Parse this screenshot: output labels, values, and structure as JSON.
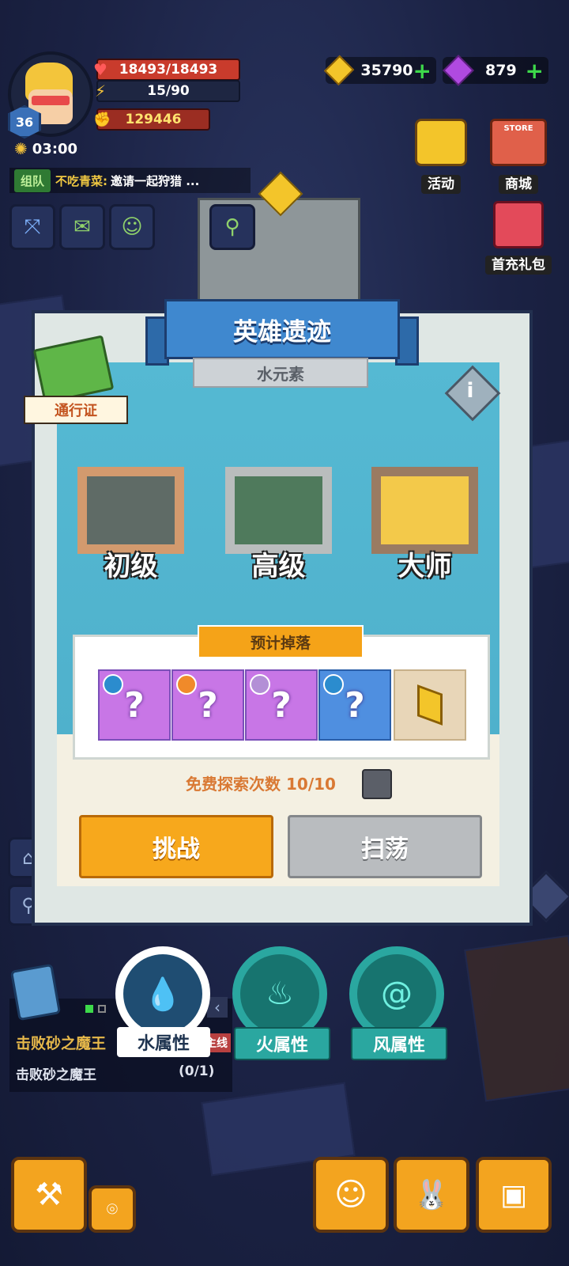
{
  "hud": {
    "level": "36",
    "hp": "18493/18493",
    "stamina": "15/90",
    "power": "129446",
    "gold": "35790",
    "gems": "879",
    "timer": "03:00",
    "chat_tag": "组队",
    "chat_user": "不吃青菜:",
    "chat_text": "邀请一起狩猎 ...",
    "events_label": "活动",
    "shop_label": "商城",
    "store_sign": "STORE",
    "first_recharge_label": "首充礼包"
  },
  "panel": {
    "title": "英雄遗迹",
    "subtitle": "水元素",
    "pass_label": "通行证",
    "info_glyph": "i",
    "difficulties": [
      {
        "label": "初级"
      },
      {
        "label": "高级"
      },
      {
        "label": "大师"
      }
    ],
    "drops_title": "预计掉落",
    "drops": [
      {
        "symbol": "?",
        "element": "water",
        "color": "#c876e6"
      },
      {
        "symbol": "?",
        "element": "fire",
        "color": "#c876e6"
      },
      {
        "symbol": "?",
        "element": "moon",
        "color": "#c876e6"
      },
      {
        "symbol": "?",
        "element": "water",
        "color": "#4f8fe0"
      },
      {
        "symbol": "gold-gem",
        "element": "",
        "color": "#e8d6b8"
      }
    ],
    "free_explore": "免费探索次数 10/10",
    "challenge_label": "挑战",
    "sweep_label": "扫荡"
  },
  "elements": [
    {
      "label": "水属性",
      "icon": "water-drops-icon",
      "selected": true
    },
    {
      "label": "火属性",
      "icon": "flame-icon",
      "selected": false
    },
    {
      "label": "风属性",
      "icon": "wind-swirl-icon",
      "selected": false
    }
  ],
  "quest": {
    "title": "击败砂之魔王",
    "desc": "击败砂之魔王",
    "progress": "(0/1)",
    "tag": "主线"
  },
  "colors": {
    "accent_orange": "#f5a318",
    "panel_blue": "#3f88cf",
    "button_gray": "#b9bcbf",
    "element_teal": "#2aa7a0"
  }
}
